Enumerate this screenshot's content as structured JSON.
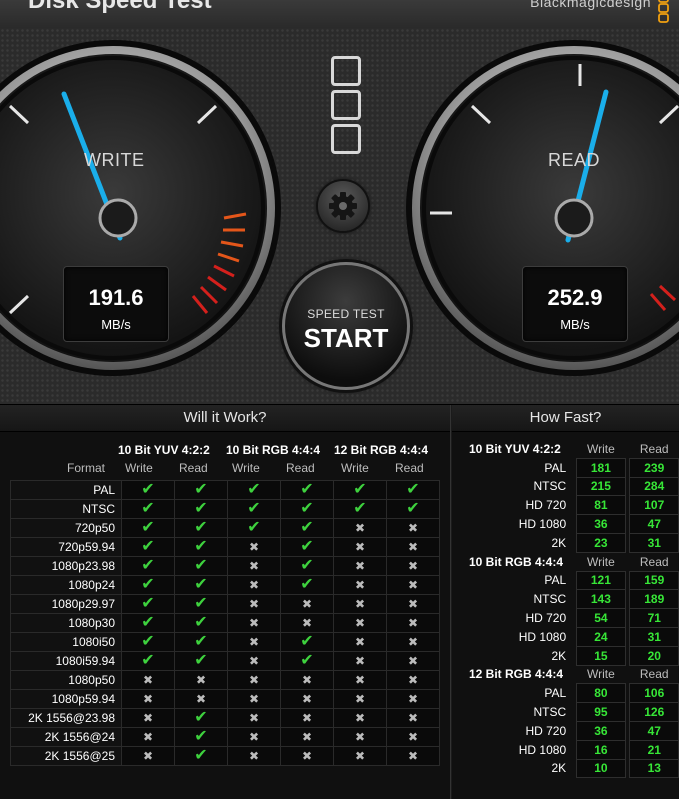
{
  "app": {
    "title": "Disk Speed Test",
    "brand": "Blackmagicdesign"
  },
  "gauges": {
    "write": {
      "label": "WRITE",
      "value": "191.6",
      "unit": "MB/s",
      "color": "#1aaeea"
    },
    "read": {
      "label": "READ",
      "value": "252.9",
      "unit": "MB/s",
      "color": "#1aaeea"
    }
  },
  "start_button": {
    "top": "SPEED TEST",
    "main": "START"
  },
  "will_it_work": {
    "title": "Will it Work?",
    "format_label": "Format",
    "groups": [
      "10 Bit YUV 4:2:2",
      "10 Bit RGB 4:4:4",
      "12 Bit RGB 4:4:4"
    ],
    "sub_headers": [
      "Write",
      "Read",
      "Write",
      "Read",
      "Write",
      "Read"
    ],
    "rows": [
      {
        "format": "PAL",
        "cells": [
          1,
          1,
          1,
          1,
          1,
          1
        ]
      },
      {
        "format": "NTSC",
        "cells": [
          1,
          1,
          1,
          1,
          1,
          1
        ]
      },
      {
        "format": "720p50",
        "cells": [
          1,
          1,
          1,
          1,
          0,
          0
        ]
      },
      {
        "format": "720p59.94",
        "cells": [
          1,
          1,
          0,
          1,
          0,
          0
        ]
      },
      {
        "format": "1080p23.98",
        "cells": [
          1,
          1,
          0,
          1,
          0,
          0
        ]
      },
      {
        "format": "1080p24",
        "cells": [
          1,
          1,
          0,
          1,
          0,
          0
        ]
      },
      {
        "format": "1080p29.97",
        "cells": [
          1,
          1,
          0,
          0,
          0,
          0
        ]
      },
      {
        "format": "1080p30",
        "cells": [
          1,
          1,
          0,
          0,
          0,
          0
        ]
      },
      {
        "format": "1080i50",
        "cells": [
          1,
          1,
          0,
          1,
          0,
          0
        ]
      },
      {
        "format": "1080i59.94",
        "cells": [
          1,
          1,
          0,
          1,
          0,
          0
        ]
      },
      {
        "format": "1080p50",
        "cells": [
          0,
          0,
          0,
          0,
          0,
          0
        ]
      },
      {
        "format": "1080p59.94",
        "cells": [
          0,
          0,
          0,
          0,
          0,
          0
        ]
      },
      {
        "format": "2K 1556@23.98",
        "cells": [
          0,
          1,
          0,
          0,
          0,
          0
        ]
      },
      {
        "format": "2K 1556@24",
        "cells": [
          0,
          1,
          0,
          0,
          0,
          0
        ]
      },
      {
        "format": "2K 1556@25",
        "cells": [
          0,
          1,
          0,
          0,
          0,
          0
        ]
      }
    ]
  },
  "how_fast": {
    "title": "How Fast?",
    "sections": [
      {
        "name": "10 Bit YUV 4:2:2",
        "write_label": "Write",
        "read_label": "Read",
        "rows": [
          [
            "PAL",
            "181",
            "239"
          ],
          [
            "NTSC",
            "215",
            "284"
          ],
          [
            "HD 720",
            "81",
            "107"
          ],
          [
            "HD 1080",
            "36",
            "47"
          ],
          [
            "2K",
            "23",
            "31"
          ]
        ]
      },
      {
        "name": "10 Bit RGB 4:4:4",
        "write_label": "Write",
        "read_label": "Read",
        "rows": [
          [
            "PAL",
            "121",
            "159"
          ],
          [
            "NTSC",
            "143",
            "189"
          ],
          [
            "HD 720",
            "54",
            "71"
          ],
          [
            "HD 1080",
            "24",
            "31"
          ],
          [
            "2K",
            "15",
            "20"
          ]
        ]
      },
      {
        "name": "12 Bit RGB 4:4:4",
        "write_label": "Write",
        "read_label": "Read",
        "rows": [
          [
            "PAL",
            "80",
            "106"
          ],
          [
            "NTSC",
            "95",
            "126"
          ],
          [
            "HD 720",
            "36",
            "47"
          ],
          [
            "HD 1080",
            "16",
            "21"
          ],
          [
            "2K",
            "10",
            "13"
          ]
        ]
      }
    ]
  },
  "icons": {
    "ok": "checkmark-icon",
    "no": "cross-icon"
  }
}
